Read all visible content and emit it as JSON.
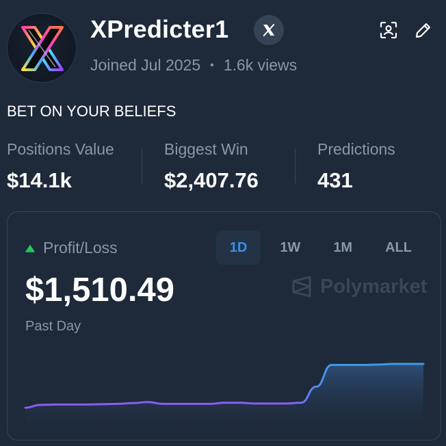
{
  "profile": {
    "username": "XPredicter1",
    "joined": "Joined Jul 2025",
    "separator": "•",
    "views": "1.6k views",
    "bio": "BET ON YOUR BELIEFS"
  },
  "stats": [
    {
      "label": "Positions Value",
      "value": "$14.1k"
    },
    {
      "label": "Biggest Win",
      "value": "$2,407.76"
    },
    {
      "label": "Predictions",
      "value": "431"
    }
  ],
  "pnl": {
    "label": "Profit/Loss",
    "value": "$1,510.49",
    "period": "Past Day",
    "brand": "Polymarket",
    "tabs": [
      {
        "label": "1D",
        "active": true
      },
      {
        "label": "1W",
        "active": false
      },
      {
        "label": "1M",
        "active": false
      },
      {
        "label": "ALL",
        "active": false
      }
    ]
  },
  "icons": {
    "x_badge": "x-logo-icon",
    "scan": "face-scan-icon",
    "edit": "pencil-icon",
    "trend": "triangle-up-icon",
    "brand": "polymarket-logo-icon"
  },
  "colors": {
    "background": "#1e2939",
    "positive": "#22c55e",
    "accent": "#3b8fe8",
    "line_start": "#8b5cf6",
    "line_end": "#3b9ae8"
  },
  "chart_data": {
    "type": "line",
    "series": [
      {
        "values": [
          0,
          8,
          9,
          9,
          9,
          10,
          11,
          13,
          16,
          11,
          11,
          11,
          11,
          14,
          14,
          12,
          12,
          12,
          14,
          60,
          122,
          122,
          122,
          123,
          125,
          125,
          125
        ]
      }
    ],
    "ylim": [
      0,
      125
    ],
    "grid": false
  }
}
